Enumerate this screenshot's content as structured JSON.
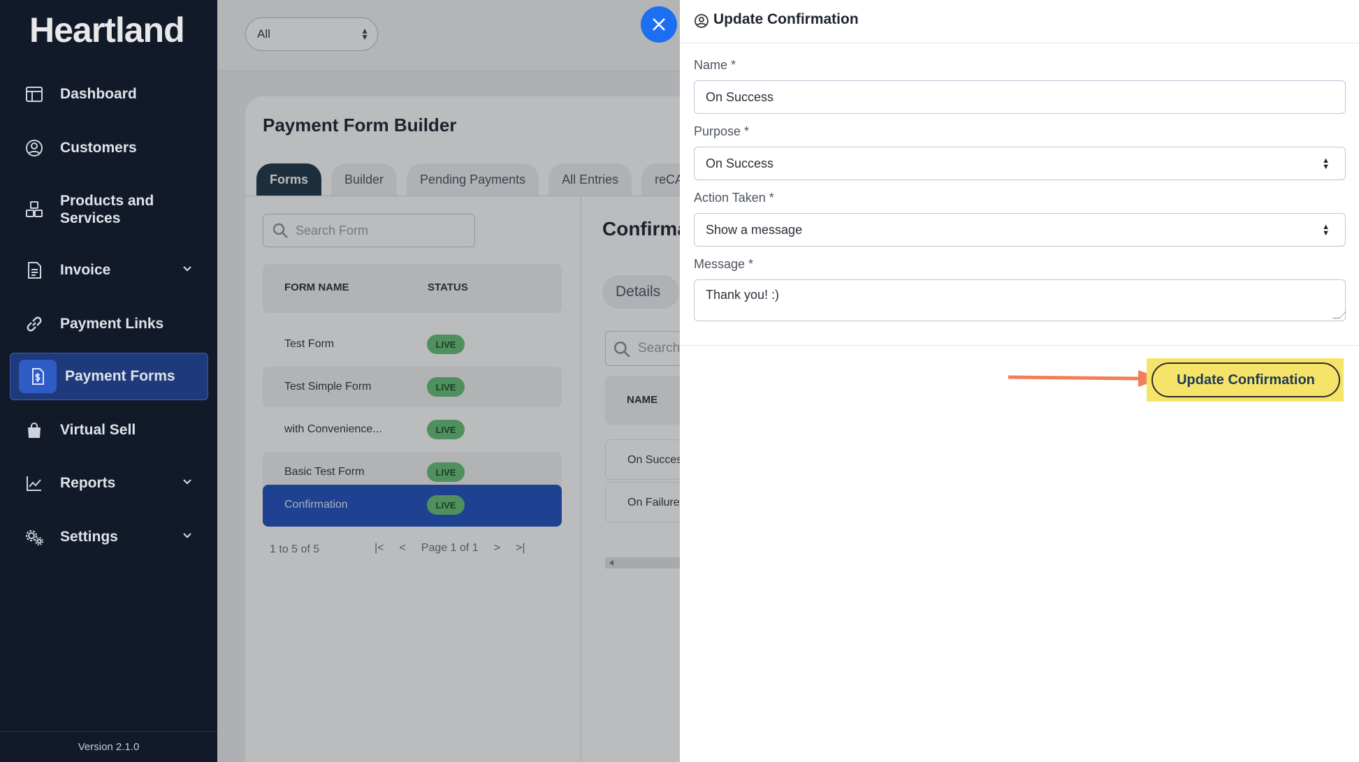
{
  "app": {
    "logo": "Heartland",
    "version": "Version 2.1.0"
  },
  "sidebar": {
    "items": [
      {
        "label": "Dashboard"
      },
      {
        "label": "Customers"
      },
      {
        "label": "Products and Services"
      },
      {
        "label": "Invoice"
      },
      {
        "label": "Payment Links"
      },
      {
        "label": "Payment Forms"
      },
      {
        "label": "Virtual Sell"
      },
      {
        "label": "Reports"
      },
      {
        "label": "Settings"
      }
    ]
  },
  "topbar": {
    "filter_value": "All"
  },
  "builder": {
    "title": "Payment Form Builder",
    "tabs": [
      "Forms",
      "Builder",
      "Pending Payments",
      "All Entries",
      "reCA"
    ],
    "search_placeholder": "Search Form",
    "columns": {
      "name": "FORM NAME",
      "status": "STATUS"
    },
    "rows": [
      {
        "name": "Test Form",
        "status": "LIVE"
      },
      {
        "name": "Test Simple Form",
        "status": "LIVE"
      },
      {
        "name": "with Convenience...",
        "status": "LIVE"
      },
      {
        "name": "Basic Test Form",
        "status": "LIVE"
      },
      {
        "name": "Confirmation",
        "status": "LIVE"
      }
    ],
    "pager": {
      "range": "1 to 5 of 5",
      "page": "Page 1 of 1"
    }
  },
  "confirmations": {
    "title": "Confirma",
    "details_tab": "Details",
    "search_placeholder": "Search",
    "column_name": "NAME",
    "rows": [
      "On Success",
      "On Failure"
    ]
  },
  "panel": {
    "title": "Update Confirmation",
    "fields": {
      "name_label": "Name *",
      "name_value": "On Success",
      "purpose_label": "Purpose *",
      "purpose_value": "On Success",
      "action_label": "Action Taken *",
      "action_value": "Show a message",
      "message_label": "Message *",
      "message_value": "Thank you! :)"
    },
    "submit_label": "Update Confirmation"
  },
  "colors": {
    "sidebar_bg": "#121a2a",
    "active_nav": "#1e3a7a",
    "primary": "#1d6ff2",
    "highlight": "#f6e46a",
    "arrow": "#f07f5b",
    "live_badge": "#66c078"
  }
}
